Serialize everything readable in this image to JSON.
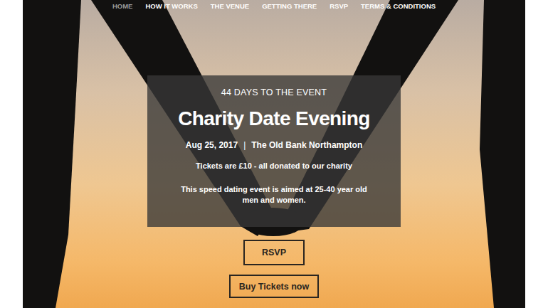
{
  "nav": {
    "items": [
      {
        "label": "HOME",
        "selected": true
      },
      {
        "label": "HOW IT WORKS",
        "selected": false
      },
      {
        "label": "THE VENUE",
        "selected": false
      },
      {
        "label": "GETTING THERE",
        "selected": false
      },
      {
        "label": "RSVP",
        "selected": false
      },
      {
        "label": "TERMS & CONDITIONS",
        "selected": false
      }
    ]
  },
  "hero": {
    "countdown": "44 DAYS TO THE EVENT",
    "title": "Charity Date Evening",
    "date": "Aug 25, 2017",
    "separator": "|",
    "venue": "The Old Bank Northampton",
    "tickets": "Tickets are £10 - all donated to our charity",
    "description": "This speed dating event is aimed at 25-40 year old men and women."
  },
  "buttons": [
    {
      "label": "RSVP"
    },
    {
      "label": "Buy Tickets now"
    }
  ]
}
